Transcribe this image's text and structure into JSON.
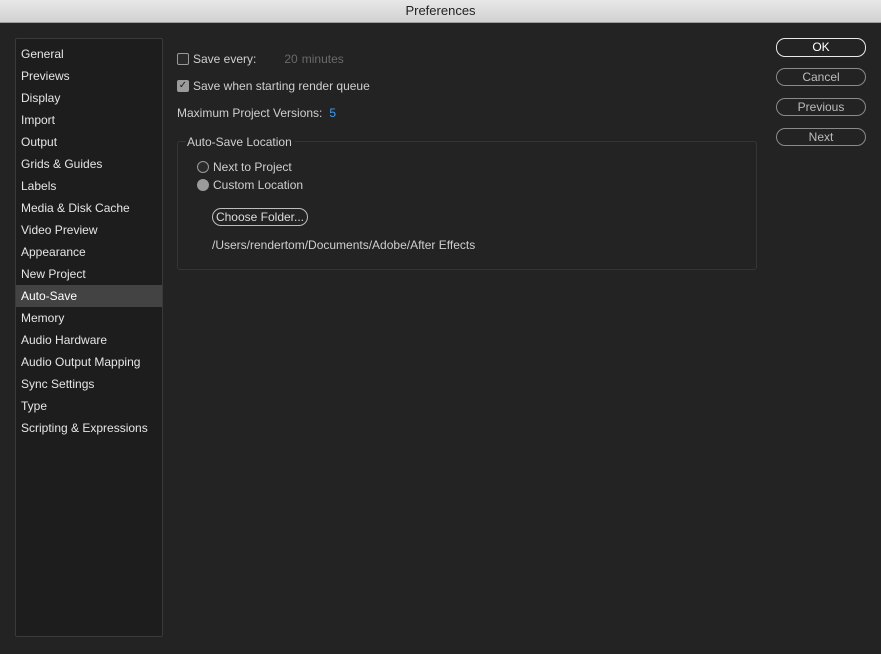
{
  "window": {
    "title": "Preferences"
  },
  "sidebar": {
    "items": [
      {
        "label": "General"
      },
      {
        "label": "Previews"
      },
      {
        "label": "Display"
      },
      {
        "label": "Import"
      },
      {
        "label": "Output"
      },
      {
        "label": "Grids & Guides"
      },
      {
        "label": "Labels"
      },
      {
        "label": "Media & Disk Cache"
      },
      {
        "label": "Video Preview"
      },
      {
        "label": "Appearance"
      },
      {
        "label": "New Project"
      },
      {
        "label": "Auto-Save"
      },
      {
        "label": "Memory"
      },
      {
        "label": "Audio Hardware"
      },
      {
        "label": "Audio Output Mapping"
      },
      {
        "label": "Sync Settings"
      },
      {
        "label": "Type"
      },
      {
        "label": "Scripting & Expressions"
      }
    ],
    "selected": "Auto-Save"
  },
  "autosave": {
    "save_every_label": "Save every:",
    "save_every_checked": false,
    "save_every_value": "20",
    "save_every_unit": "minutes",
    "save_on_render_label": "Save when starting render queue",
    "save_on_render_checked": true,
    "max_versions_label": "Maximum Project Versions:",
    "max_versions_value": "5"
  },
  "location": {
    "group_title": "Auto-Save Location",
    "option_next": "Next to Project",
    "option_custom": "Custom Location",
    "selected": "Custom Location",
    "choose_folder_label": "Choose Folder...",
    "path": "/Users/rendertom/Documents/Adobe/After Effects"
  },
  "buttons": {
    "ok": "OK",
    "cancel": "Cancel",
    "previous": "Previous",
    "next": "Next"
  },
  "colors": {
    "background": "#232323",
    "accent": "#3f9bf2",
    "selected_item": "#434343"
  }
}
